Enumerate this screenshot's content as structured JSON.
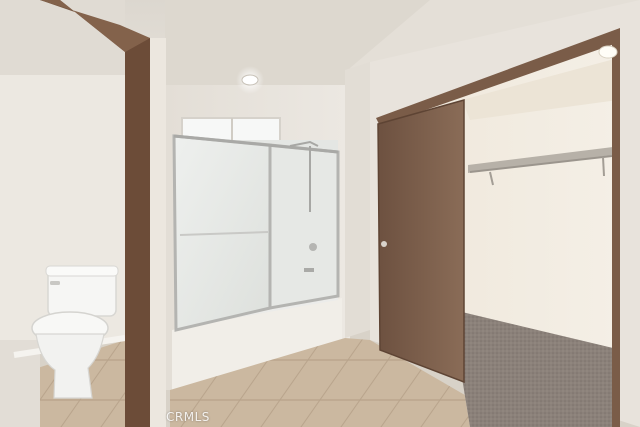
{
  "watermark": {
    "text": "CRMLS"
  },
  "colors": {
    "wall": "#e6e1d9",
    "ceiling": "#dcd6cd",
    "floor_tile": "#c9b59d",
    "door_wood": "#7a5a43",
    "closet_door": "#7c5e49",
    "carpet": "#8a7f76",
    "glass": "#e9ebe8",
    "metal": "#b9b9b6"
  }
}
